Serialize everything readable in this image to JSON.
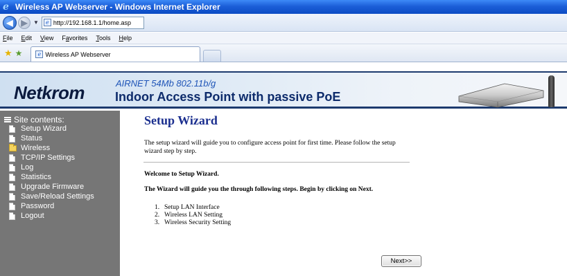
{
  "window": {
    "title": "Wireless AP Webserver - Windows Internet Explorer"
  },
  "address": {
    "url": "http://192.168.1.1/home.asp"
  },
  "menu": {
    "items": [
      {
        "label": "File",
        "accel": "F"
      },
      {
        "label": "Edit",
        "accel": "E"
      },
      {
        "label": "View",
        "accel": "V"
      },
      {
        "label": "Favorites",
        "accel": "a"
      },
      {
        "label": "Tools",
        "accel": "T"
      },
      {
        "label": "Help",
        "accel": "H"
      }
    ]
  },
  "tabs": {
    "active_label": "Wireless AP Webserver"
  },
  "banner": {
    "logo": "Netkrom",
    "subtitle": "AIRNET 54Mb 802.11b/g",
    "title": "Indoor Access Point with passive PoE"
  },
  "sidebar": {
    "heading": "Site contents:",
    "items": [
      {
        "label": "Setup Wizard",
        "icon": "document-icon"
      },
      {
        "label": "Status",
        "icon": "document-icon"
      },
      {
        "label": "Wireless",
        "icon": "folder-icon"
      },
      {
        "label": "TCP/IP Settings",
        "icon": "document-icon"
      },
      {
        "label": "Log",
        "icon": "document-icon"
      },
      {
        "label": "Statistics",
        "icon": "document-icon"
      },
      {
        "label": "Upgrade Firmware",
        "icon": "document-icon"
      },
      {
        "label": "Save/Reload Settings",
        "icon": "document-icon"
      },
      {
        "label": "Password",
        "icon": "document-icon"
      },
      {
        "label": "Logout",
        "icon": "document-icon"
      }
    ]
  },
  "main": {
    "title": "Setup Wizard",
    "intro": "The setup wizard will guide you to configure access point for first time. Please follow the setup wizard step by step.",
    "welcome": "Welcome to Setup Wizard.",
    "guide": "The Wizard will guide you the through following steps. Begin by clicking on Next.",
    "steps": [
      {
        "num": "1.",
        "label": "Setup LAN Interface"
      },
      {
        "num": "2.",
        "label": "Wireless LAN Setting"
      },
      {
        "num": "3.",
        "label": "Wireless Security Setting"
      }
    ],
    "next_label": "Next>>"
  },
  "colors": {
    "title_bar": "#0b4bc4",
    "sidebar_bg": "#767676",
    "heading_blue": "#1b2f8f",
    "banner_title": "#0d2b6b"
  }
}
